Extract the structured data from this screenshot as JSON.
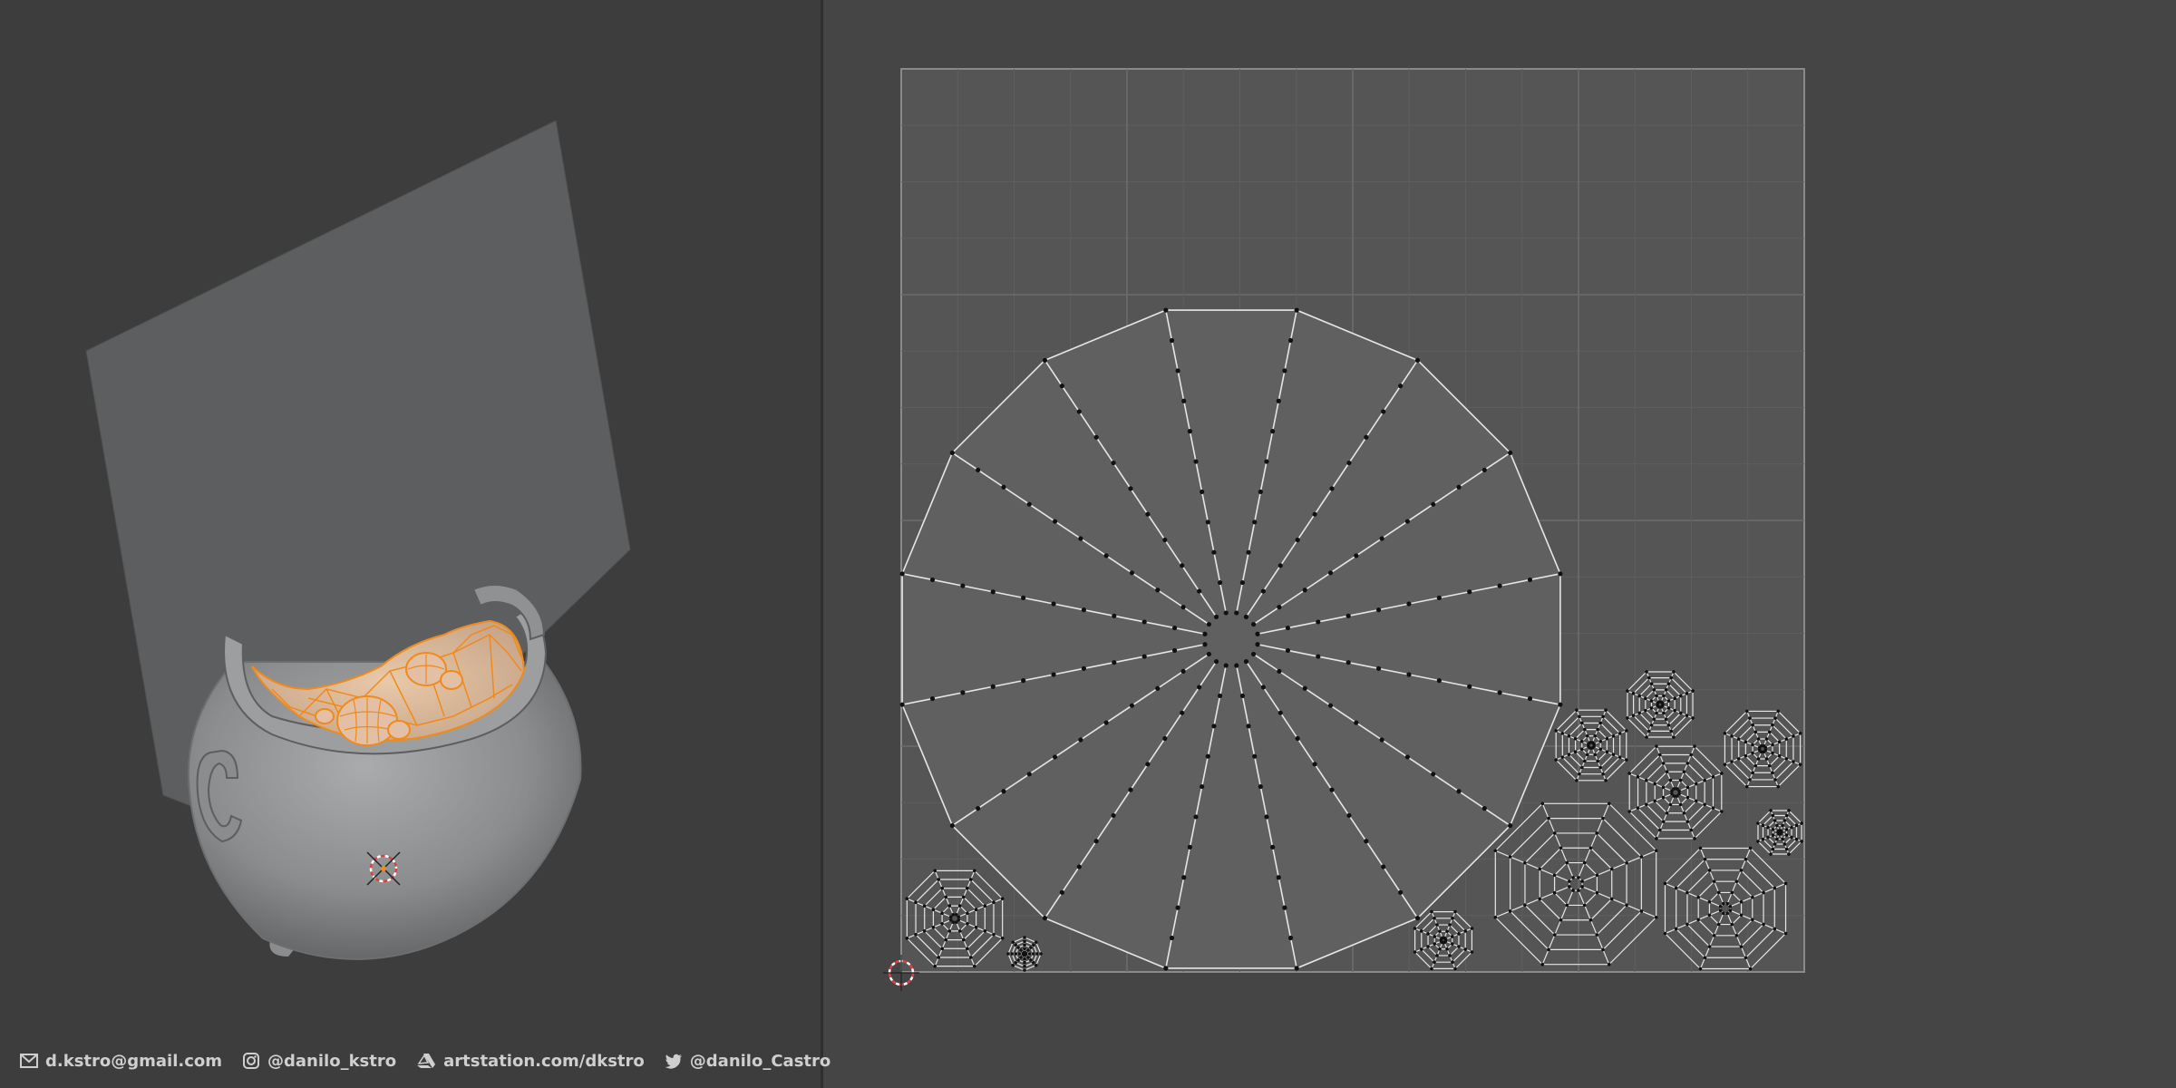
{
  "footer": {
    "email": "d.kstro@gmail.com",
    "instagram": "@danilo_kstro",
    "artstation": "artstation.com/dkstro",
    "twitter": "@danilo_Castro"
  },
  "colors": {
    "viewport_bg": "#3d3d3d",
    "uv_bg": "#454545",
    "uv_tile": "#555555",
    "mesh_gray": "#8d8f90",
    "selection_orange": "#f08a1a",
    "uv_edge": "#e6e6e6",
    "uv_vertex": "#111111"
  },
  "icons": [
    "mail-icon",
    "instagram-icon",
    "artstation-icon",
    "twitter-icon",
    "3d-cursor-icon",
    "2d-cursor-icon"
  ]
}
